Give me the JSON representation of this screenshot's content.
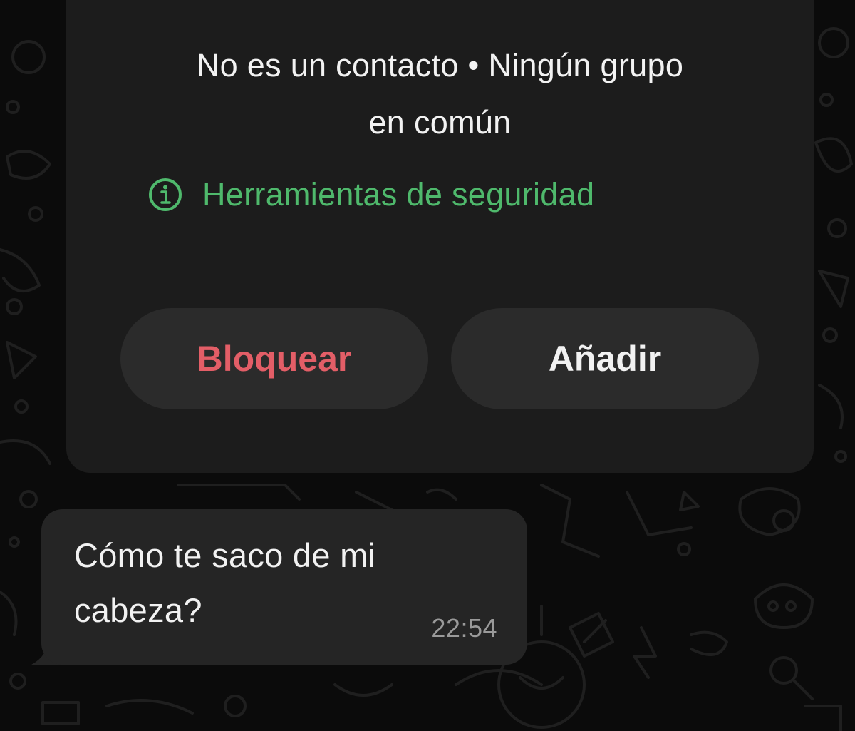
{
  "contact_info": {
    "status_line1": "No es un contacto • Ningún grupo",
    "status_line2": "en común",
    "safety_tools_label": "Herramientas de seguridad",
    "accent_color": "#4fb96c"
  },
  "actions": {
    "block_label": "Bloquear",
    "block_color": "#e35e67",
    "add_label": "Añadir"
  },
  "message": {
    "line1": "Cómo te saco de mi",
    "line2": "cabeza?",
    "time": "22:54"
  },
  "icons": {
    "safety": "info-circle-icon"
  }
}
